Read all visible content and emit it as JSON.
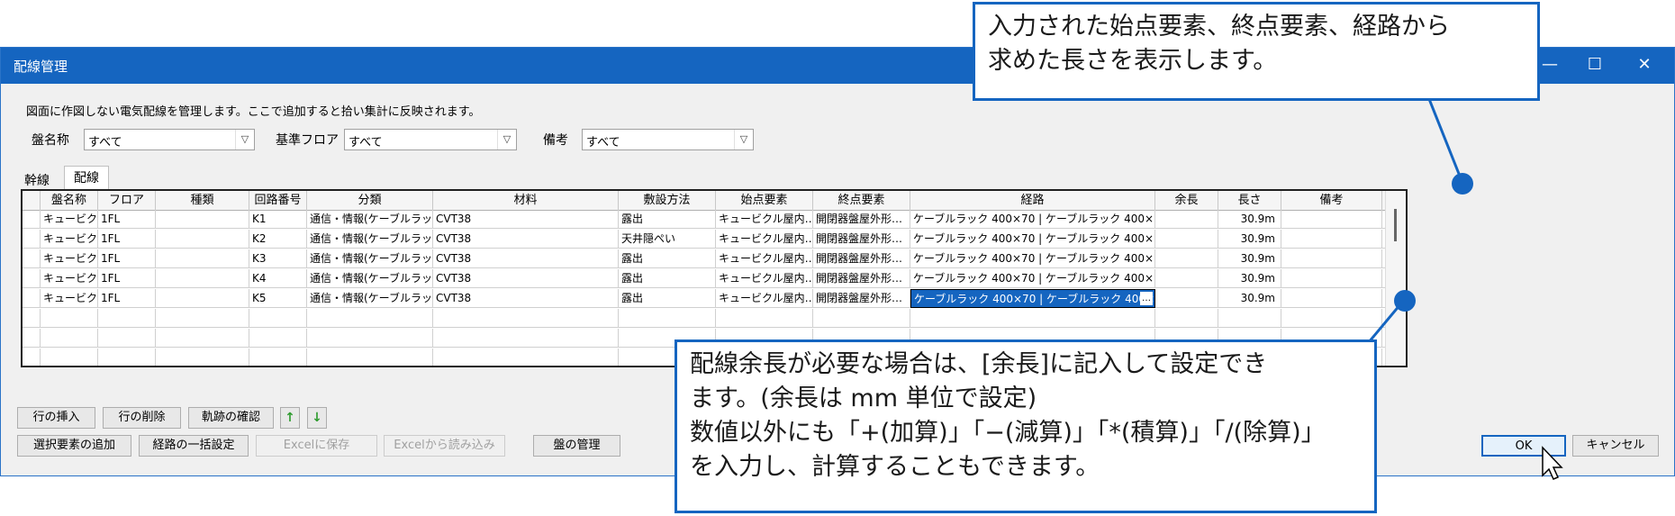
{
  "window": {
    "title": "配線管理",
    "controls": {
      "minimize": "—",
      "maximize": "☐",
      "close": "✕"
    }
  },
  "description": "図面に作図しない電気配線を管理します。ここで追加すると拾い集計に反映されます。",
  "filters": [
    {
      "label": "盤名称",
      "value": "すべて"
    },
    {
      "label": "基準フロア",
      "value": "すべて"
    },
    {
      "label": "備考",
      "value": "すべて"
    }
  ],
  "tabs": [
    "幹線",
    "配線"
  ],
  "grid": {
    "headers": [
      "盤名称",
      "フロア",
      "種類",
      "回路番号",
      "分類",
      "材料",
      "敷設方法",
      "始点要素",
      "終点要素",
      "経路",
      "余長",
      "長さ",
      "備考"
    ],
    "rows": [
      [
        "キュービク…",
        "1FL",
        "",
        "K1",
        "通信・情報(ケーブルラック)",
        "CVT38",
        "露出",
        "キュービクル屋内…",
        "開閉器盤屋外形…",
        "ケーブルラック 400×70 | ケーブルラック 400×70 | …",
        "",
        "30.9m",
        ""
      ],
      [
        "キュービク…",
        "1FL",
        "",
        "K2",
        "通信・情報(ケーブルラック)",
        "CVT38",
        "天井隠ぺい",
        "キュービクル屋内…",
        "開閉器盤屋外形…",
        "ケーブルラック 400×70 | ケーブルラック 400×70 | …",
        "",
        "30.9m",
        ""
      ],
      [
        "キュービク…",
        "1FL",
        "",
        "K3",
        "通信・情報(ケーブルラック)",
        "CVT38",
        "露出",
        "キュービクル屋内…",
        "開閉器盤屋外形…",
        "ケーブルラック 400×70 | ケーブルラック 400×70 | …",
        "",
        "30.9m",
        ""
      ],
      [
        "キュービク…",
        "1FL",
        "",
        "K4",
        "通信・情報(ケーブルラック)",
        "CVT38",
        "露出",
        "キュービクル屋内…",
        "開閉器盤屋外形…",
        "ケーブルラック 400×70 | ケーブルラック 400×70 | …",
        "",
        "30.9m",
        ""
      ],
      [
        "キュービク…",
        "1FL",
        "",
        "K5",
        "通信・情報(ケーブルラック)",
        "CVT38",
        "露出",
        "キュービクル屋内…",
        "開閉器盤屋外形…",
        "ケーブルラック 400×70 | ケーブルラック 400×…",
        "",
        "30.9m",
        ""
      ]
    ],
    "edit_ellipsis": "…"
  },
  "buttons": {
    "insert_row": "行の挿入",
    "delete_row": "行の削除",
    "check_trace": "軌跡の確認",
    "up": "↑",
    "down": "↓",
    "add_selection": "選択要素の追加",
    "bulk_route": "経路の一括設定",
    "save_excel": "Excelに保存",
    "load_excel": "Excelから読み込み",
    "panel_mgmt": "盤の管理",
    "ok": "OK",
    "cancel": "キャンセル"
  },
  "callouts": {
    "top": [
      "入力された始点要素、終点要素、経路から",
      "求めた長さを表示します。"
    ],
    "bottom": [
      "配線余長が必要な場合は、[余長]に記入して設定でき",
      "ます。(余長は mm 単位で設定)",
      "数値以外にも「+(加算)」「−(減算)」「*(積算)」「/(除算)」",
      "を入力し、計算することもできます。"
    ]
  },
  "colors": {
    "accent": "#1565c0",
    "titlebar": "#1565c0",
    "selection": "#1565c0"
  }
}
